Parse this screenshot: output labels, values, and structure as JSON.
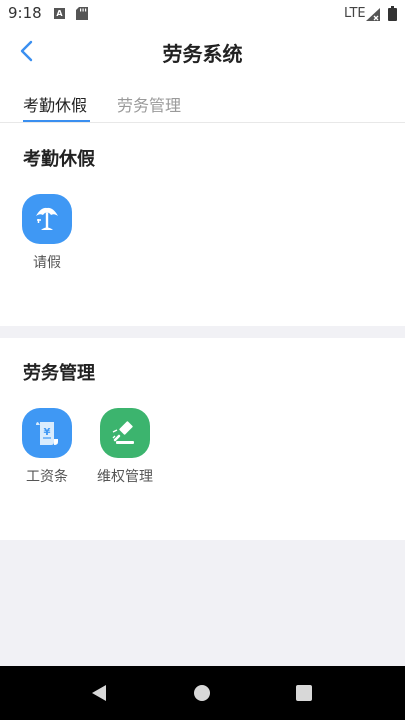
{
  "status_bar": {
    "time": "9:18",
    "network": "LTE"
  },
  "header": {
    "title": "劳务系统"
  },
  "tabs": [
    {
      "label": "考勤休假",
      "active": true
    },
    {
      "label": "劳务管理",
      "active": false
    }
  ],
  "sections": [
    {
      "title": "考勤休假",
      "apps": [
        {
          "label": "请假",
          "icon": "beach-umbrella-icon",
          "color": "#3f98f4"
        }
      ]
    },
    {
      "title": "劳务管理",
      "apps": [
        {
          "label": "工资条",
          "icon": "payslip-scroll-icon",
          "color": "#3f98f4"
        },
        {
          "label": "维权管理",
          "icon": "gavel-icon",
          "color": "#3cb46e"
        }
      ]
    }
  ],
  "colors": {
    "accent": "#3a8ff0",
    "page_background": "#f1f1f5"
  }
}
